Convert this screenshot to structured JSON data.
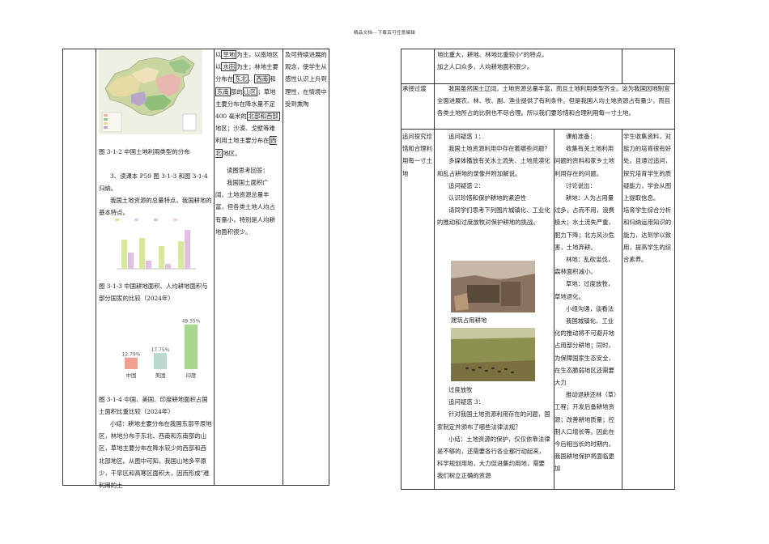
{
  "header": "精品文档---下载后可任意编辑",
  "left_page": {
    "fig_caption_1": "图 3-1-2  中国土地利用类型的分布",
    "para_1": "3、读课本 P59 图 3-1-3 和图 3-1-4 归纳。",
    "para_2": "我国土地资源的总量特点，我国耕地的基本特点。",
    "fig_caption_2": "图 3-1-3  中国耕地面积、人均耕地面积与部分国家的比较（2024年）",
    "chart2": {
      "type": "bar",
      "categories": [
        "中国",
        "美国",
        "印度"
      ],
      "values": [
        12.79,
        17.75,
        49.35
      ],
      "value_labels": [
        "12.79%",
        "17.75%",
        "49.35%"
      ],
      "colors": [
        "#f0a090",
        "#b8d8d0",
        "#a8d890"
      ]
    },
    "fig_caption_3": "图 3-1-4  中国、美国、印度耕地面积占国土面积比重比较（2024年）",
    "summary": "小结：耕地主要分布在我国东部平原地区，林地分布于东北、西南和东南部的山区，草地主要分布在降水较少的西部和西北部地区。从图中可知，我国山地多平原少，干旱区和高寒区面积大，因而形成\"难利用的土",
    "col2_text": [
      {
        "pre": "以",
        "boxed": "旱地",
        "post": "为主，以南地区以"
      },
      {
        "boxed": "水田",
        "post": "为主；林地主要分布在"
      },
      {
        "boxed": "东北",
        "post": "、"
      },
      {
        "boxed": "西南",
        "post": "和"
      },
      {
        "boxed": "东南",
        "post": "部的"
      },
      {
        "boxed": "山区",
        "post": "；草地主要分布在降水量不足 400 毫米的"
      },
      {
        "boxed": "北部和西部",
        "post": "地区；沙漠、戈壁等难利用土地主要分布在"
      },
      {
        "boxed": "西北",
        "post": "地区。"
      }
    ],
    "col2_answer": "读图思考回答：",
    "col2_answer_body": "我国国土面积广阔，土地资源总量丰富，但各类土地人均占有量小，特别是人均耕地面积很少。",
    "col3_text": "及可持续进展的观念，使学生从感性认识上升到理性，在情境中受到熏陶"
  },
  "right_page": {
    "row1_text": "地比重大，耕地、林地比重较小\"的特点，加之人口众多，人均耕地面积很少。",
    "row2_label": "承接过渡",
    "row2_text": "我国虽然国土辽阔，土地资源总量丰富，而且土地利用类型齐全。这为我国因地制宜全面进展农、林、牧、副、渔业提供了有利条件。但是我国人均土地资源占有量少，而且各类土地所占的比例也不尽合理。所以我们要珍惜和合理利用每一寸土地。",
    "row3_label": "追问探究珍惜和合理利用每一寸土地",
    "q1_title": "追问疑惑 1：",
    "q1_body": "我国土地资源利用中存在着哪些问题？",
    "q1_media": "多媒体播放有关水土流失、土地荒漠化和乱占耕地的录像并附加解说。",
    "q2_title": "追问疑惑 2：",
    "q2_body": "认识珍惜和保护耕地的紧迫性",
    "q2_task": "请同学们思考下列图片城镇化、工业化的推动和过度放牧对保护耕地的挑战。",
    "photo1_caption": "建筑占用耕地",
    "photo2_caption": "过度放牧",
    "q3_title": "追问疑惑 3：",
    "q3_body": "针对我国土地资源利用存在的问题，国家制定并颁布了哪些法律法规？",
    "q3_summary": "小结：土地资源的保护，仅仅依靠法律是不够的，还需要各行各业都行动起来，科学规划用地，大力促进集约用地，需要我们树立正确的资源",
    "col2": [
      "课前准备：",
      "收集有关土地利用问题的资料和家乡土地利用存在的问题。",
      "讨论说出：",
      "耕地：人为占用量过多，占而不用，浪费极大；水土流失严重，肥力下降；北方风沙危害，土地弃耕。",
      "林地：乱砍滥伐，森林面积减小。",
      "草地：过度放牧，草地退化。",
      "小组沟通，谈看法",
      "我国城镇化、工业化的推动将不可避开地占用部分耕地；同时，为保障国家生态安全，在生态脆弱地区还需要大力",
      "推动退耕还林（草）工程；开发后备耕地资源；改善耕地质量；控制人口增长等。因此在今后相当长的时期内，我国耕地保护将面临更加"
    ],
    "col3": "学生收集资料，对能力的培育很有好处。且通过追问，探究培育学生的质疑能力，学会从图上提取信息。\n培育学生综合分析和归纳运用知识的能力，达到学以致用，提高学生的综合素养。"
  }
}
